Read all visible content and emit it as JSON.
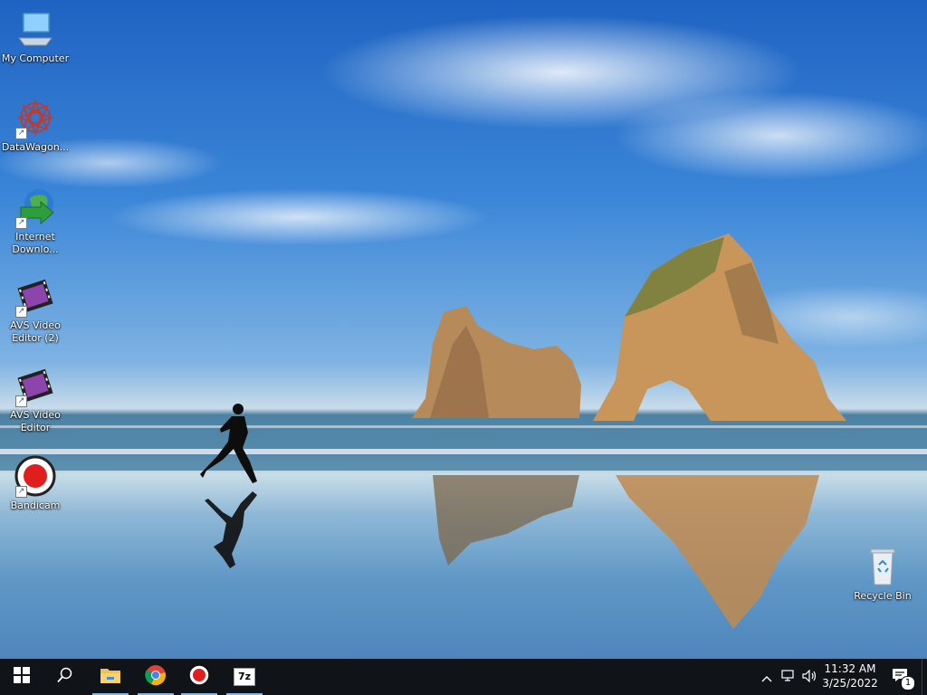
{
  "desktop": {
    "icons": [
      {
        "label": "My Computer",
        "icon": "computer-icon"
      },
      {
        "label": "DataWagon...",
        "icon": "datawagon-icon"
      },
      {
        "label": "Internet Downlo...",
        "icon": "internet-download-manager-icon"
      },
      {
        "label": "AVS Video Editor (2)",
        "icon": "avs-video-editor-icon"
      },
      {
        "label": "AVS Video Editor",
        "icon": "avs-video-editor-icon"
      },
      {
        "label": "Bandicam",
        "icon": "bandicam-icon"
      },
      {
        "label": "Recycle Bin",
        "icon": "recycle-bin-icon"
      }
    ]
  },
  "taskbar": {
    "pinned": [
      {
        "icon": "windows-start-icon"
      },
      {
        "icon": "search-icon"
      },
      {
        "icon": "file-explorer-icon"
      },
      {
        "icon": "chrome-icon"
      },
      {
        "icon": "bandicam-icon"
      },
      {
        "icon": "7zip-icon",
        "text": "7z"
      }
    ],
    "tray": {
      "time": "11:32 AM",
      "date": "3/25/2022",
      "notification_count": "1"
    },
    "colors": {
      "background": "#101317",
      "active_underline": "#7fb7e8"
    }
  }
}
